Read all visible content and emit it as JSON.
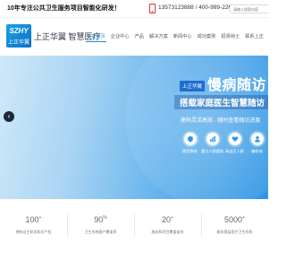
{
  "topbar": {
    "slogan": "10年专注公共卫生服务项目智能化研发！",
    "phones": "13573123888 / 400-999-2268",
    "search_placeholder": "请输入搜索内容"
  },
  "header": {
    "logo_top": "SZHY",
    "logo_bottom": "上正华翼",
    "brand": "上正华翼 智慧医疗",
    "nav": [
      {
        "label": "上正首页"
      },
      {
        "label": "企业中心"
      },
      {
        "label": "产品"
      },
      {
        "label": "解决方案"
      },
      {
        "label": "新闻中心"
      },
      {
        "label": "成功案例"
      },
      {
        "label": "招贤纳士"
      },
      {
        "label": "联系上正"
      }
    ]
  },
  "hero": {
    "badge": "上正华翼",
    "title": "慢病随访",
    "subtitle": "搭载家庭医生智慧随访",
    "desc": "建档灵活高效 · 随时查看随访进度",
    "features": [
      {
        "label": "随案审核",
        "icon": "shield-icon"
      },
      {
        "label": "重点人群跟踪",
        "icon": "chart-icon"
      },
      {
        "label": "高血压人群",
        "icon": "heart-icon"
      },
      {
        "label": "糖尿病",
        "icon": "user-icon"
      }
    ]
  },
  "stats": [
    {
      "num": "100",
      "sup": "+",
      "label": "拥有自主研发知识产权"
    },
    {
      "num": "90",
      "sup": "%",
      "label": "卫生系统客户覆盖率"
    },
    {
      "num": "20",
      "sup": "+",
      "label": "服务和项目覆盖省份"
    },
    {
      "num": "5000",
      "sup": "+",
      "label": "服务基层医疗卫生机构"
    }
  ],
  "colors": {
    "accent": "#1b8be0",
    "brand_blue": "#0b6fc7"
  }
}
